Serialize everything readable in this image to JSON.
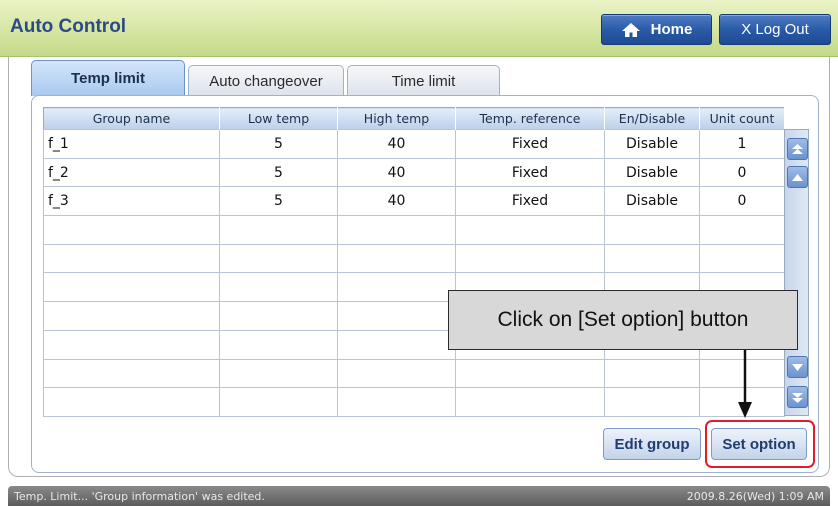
{
  "header": {
    "title": "Auto Control",
    "home_label": "Home",
    "logout_label": "X Log Out"
  },
  "tabs": [
    {
      "label": "Temp limit",
      "active": true
    },
    {
      "label": "Auto changeover",
      "active": false
    },
    {
      "label": "Time limit",
      "active": false
    }
  ],
  "table": {
    "columns": [
      "Group name",
      "Low temp",
      "High temp",
      "Temp. reference",
      "En/Disable",
      "Unit count"
    ],
    "rows": [
      [
        "f_1",
        "5",
        "40",
        "Fixed",
        "Disable",
        "1"
      ],
      [
        "f_2",
        "5",
        "40",
        "Fixed",
        "Disable",
        "0"
      ],
      [
        "f_3",
        "5",
        "40",
        "Fixed",
        "Disable",
        "0"
      ]
    ],
    "empty_rows": 7
  },
  "callout": "Click on [Set option] button",
  "buttons": {
    "edit_group": "Edit group",
    "set_option": "Set option"
  },
  "status": {
    "message": "Temp. Limit... 'Group information' was edited.",
    "datetime": "2009.8.26(Wed)  1:09 AM"
  },
  "colors": {
    "accent": "#2a5ba8",
    "title_bar": "#d6e6a2",
    "highlight": "#e21c2a"
  }
}
